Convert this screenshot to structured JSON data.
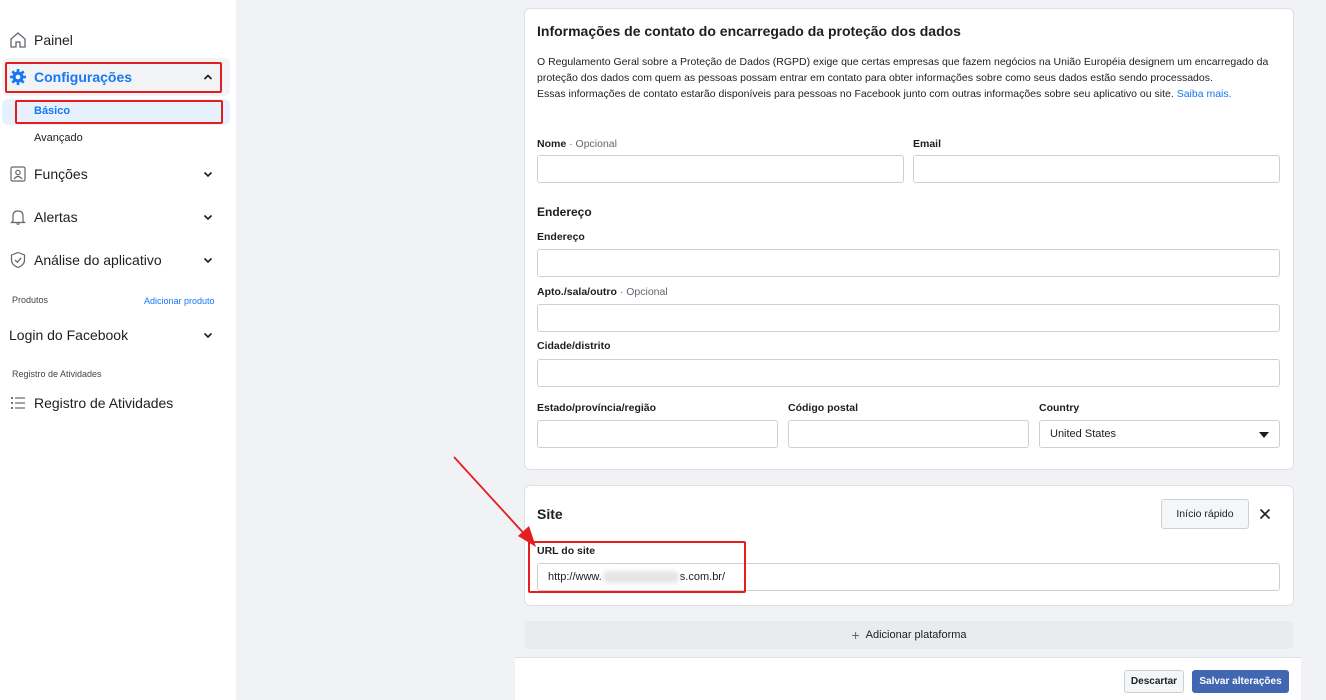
{
  "sidebar": {
    "painel": "Painel",
    "configuracoes": "Configurações",
    "basico": "Básico",
    "avancado": "Avançado",
    "funcoes": "Funções",
    "alertas": "Alertas",
    "analise": "Análise do aplicativo",
    "produtos_label": "Produtos",
    "adicionar_produto": "Adicionar produto",
    "login_facebook": "Login do Facebook",
    "registro_label": "Registro de Atividades",
    "registro_item": "Registro de Atividades"
  },
  "dpo_card": {
    "title": "Informações de contato do encarregado da proteção dos dados",
    "desc_line1": "O Regulamento Geral sobre a Proteção de Dados (RGPD) exige que certas empresas que fazem negócios na União Européia designem um encarregado da proteção dos dados com quem as pessoas possam entrar em contato para obter informações sobre como seus dados estão sendo processados.",
    "desc_line2": "Essas informações de contato estarão disponíveis para pessoas no Facebook junto com outras informações sobre seu aplicativo ou site.",
    "saiba_mais": "Saiba mais.",
    "nome_label": "Nome",
    "opcional": "· Opcional",
    "email_label": "Email",
    "endereco_heading": "Endereço",
    "endereco_label": "Endereço",
    "apto_label": "Apto./sala/outro",
    "cidade_label": "Cidade/distrito",
    "estado_label": "Estado/província/região",
    "codigo_label": "Código postal",
    "country_label": "Country",
    "country_value": "United States"
  },
  "site_card": {
    "title": "Site",
    "inicio_rapido": "Início rápido",
    "url_label": "URL do site",
    "url_prefix": "http://www.",
    "url_suffix": "s.com.br/"
  },
  "adicionar_plataforma": "Adicionar plataforma",
  "footer": {
    "descartar": "Descartar",
    "salvar": "Salvar alterações"
  },
  "colors": {
    "accent": "#1877f2",
    "annotation_red": "#e41e1e",
    "save_button": "#4267b2"
  }
}
